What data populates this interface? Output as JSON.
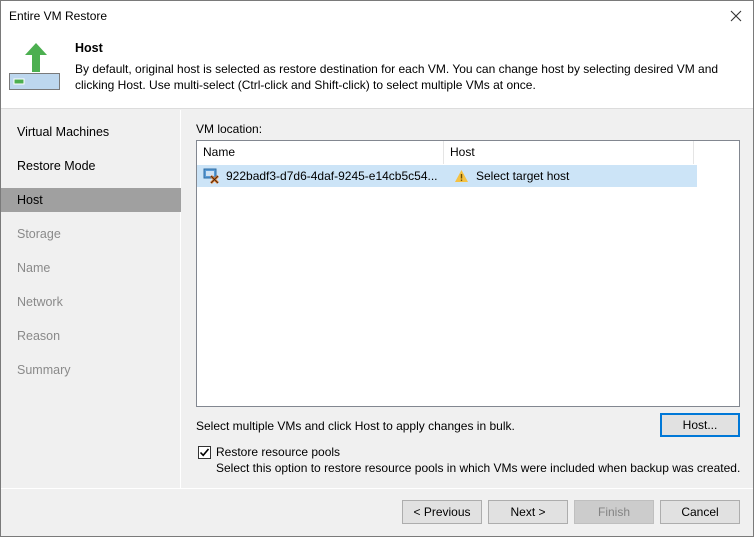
{
  "window": {
    "title": "Entire VM Restore",
    "close_icon": "close-x-icon"
  },
  "header": {
    "icon": "restore-upload-icon",
    "title": "Host",
    "description": "By default, original host is selected as restore destination for each VM. You can change host by selecting desired VM and clicking Host. Use multi-select (Ctrl-click and Shift-click) to select multiple VMs at once."
  },
  "sidebar": {
    "items": [
      {
        "label": "Virtual Machines",
        "state": "done"
      },
      {
        "label": "Restore Mode",
        "state": "done"
      },
      {
        "label": "Host",
        "state": "active"
      },
      {
        "label": "Storage",
        "state": "future"
      },
      {
        "label": "Name",
        "state": "future"
      },
      {
        "label": "Network",
        "state": "future"
      },
      {
        "label": "Reason",
        "state": "future"
      },
      {
        "label": "Summary",
        "state": "future"
      }
    ]
  },
  "main": {
    "vm_location_label": "VM location:",
    "columns": [
      "Name",
      "Host"
    ],
    "rows": [
      {
        "icon": "vm-error-icon",
        "name": "922badf3-d7d6-4daf-9245-e14cb5c54...",
        "host_icon": "warning-icon",
        "host": "Select target host",
        "selected": true
      }
    ],
    "bulk_hint": "Select multiple VMs and click Host to apply changes in bulk.",
    "host_button": "Host...",
    "restore_pools": {
      "checked": true,
      "label": "Restore resource pools",
      "description": "Select this option to restore resource pools in which VMs were included when backup was created."
    }
  },
  "footer": {
    "previous": "< Previous",
    "next": "Next >",
    "finish": "Finish",
    "cancel": "Cancel"
  },
  "colors": {
    "active_nav": "#a0a0a0",
    "selection": "#cce4f7",
    "focus_border": "#0078d7",
    "arrow_green": "#4caf50"
  }
}
